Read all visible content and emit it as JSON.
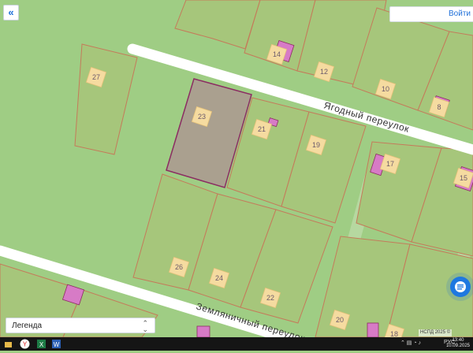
{
  "ui": {
    "collapse_label": "«",
    "login_label": "Войти",
    "legend_label": "Легенда",
    "copyright": "НСПД 2025 ©"
  },
  "streets": [
    "Ягодный переулок",
    "Земляничный переулок"
  ],
  "parcels": [
    "27",
    "23",
    "21",
    "19",
    "17",
    "15",
    "14",
    "12",
    "10",
    "8",
    "26",
    "24",
    "22",
    "20",
    "18"
  ],
  "taskbar": {
    "lang": "РУС",
    "time": "13:40",
    "date": "10.09.2025"
  },
  "colors": {
    "ground": "#9fcd84",
    "parcel_fill": "#a6c67b",
    "parcel_border": "#c57a5a",
    "selected_parcel_fill": "#aaa08f",
    "selected_parcel_border": "#8b2d62",
    "road": "#ffffff",
    "path": "#b6d8a0",
    "building_label_fill": "#f5dba0",
    "building_pink": "#d77bc6",
    "accent": "#1e78e0"
  }
}
